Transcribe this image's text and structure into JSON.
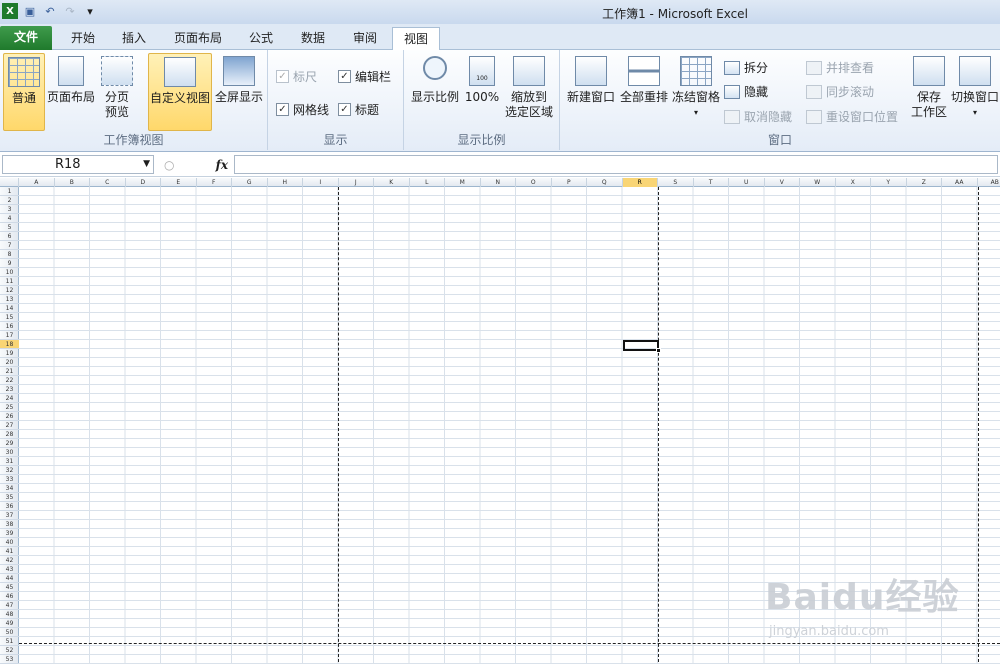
{
  "window": {
    "title": "工作簿1 - Microsoft Excel"
  },
  "tabs": {
    "file": "文件",
    "home": "开始",
    "insert": "插入",
    "page_layout": "页面布局",
    "formulas": "公式",
    "data": "数据",
    "review": "审阅",
    "view": "视图"
  },
  "ribbon": {
    "workbook_views": {
      "label": "工作簿视图",
      "normal": "普通",
      "page_layout": "页面布局",
      "page_break_1": "分页",
      "page_break_2": "预览",
      "custom_views": "自定义视图",
      "full_screen": "全屏显示"
    },
    "show": {
      "label": "显示",
      "ruler": "标尺",
      "formula_bar": "编辑栏",
      "gridlines": "网格线",
      "headings": "标题",
      "ruler_checked": "✓",
      "formula_bar_checked": "✓",
      "gridlines_checked": "✓",
      "headings_checked": "✓"
    },
    "zoom": {
      "label": "显示比例",
      "zoom": "显示比例",
      "zoom_100": "100%",
      "zoom_sel_1": "缩放到",
      "zoom_sel_2": "选定区域",
      "icon_100": "100"
    },
    "window": {
      "label": "窗口",
      "new_window": "新建窗口",
      "arrange_all": "全部重排",
      "freeze_panes": "冻结窗格",
      "split": "拆分",
      "hide": "隐藏",
      "unhide": "取消隐藏",
      "side_by_side": "并排查看",
      "sync_scroll": "同步滚动",
      "reset_pos": "重设窗口位置",
      "save_ws_1": "保存",
      "save_ws_2": "工作区",
      "switch_windows": "切换窗口"
    }
  },
  "formula_bar": {
    "name_box": "R18",
    "fx": "fx",
    "value": ""
  },
  "columns": [
    "A",
    "B",
    "C",
    "D",
    "E",
    "F",
    "G",
    "H",
    "I",
    "J",
    "K",
    "L",
    "M",
    "N",
    "O",
    "P",
    "Q",
    "R",
    "S",
    "T",
    "U",
    "V",
    "W",
    "X",
    "Y",
    "Z",
    "AA",
    "AB"
  ],
  "active_cell": {
    "column": "R",
    "row": 18
  },
  "rows": [
    "1",
    "2",
    "3",
    "4",
    "5",
    "6",
    "7",
    "8",
    "9",
    "10",
    "11",
    "12",
    "13",
    "14",
    "15",
    "16",
    "17",
    "18",
    "19",
    "20",
    "21",
    "22",
    "23",
    "24",
    "25",
    "26",
    "27",
    "28",
    "29",
    "30",
    "31",
    "32",
    "33",
    "34",
    "35",
    "36",
    "37",
    "38",
    "39",
    "40",
    "41",
    "42",
    "43",
    "44",
    "45",
    "46",
    "47",
    "48",
    "49",
    "50",
    "51",
    "52",
    "53"
  ],
  "watermark": {
    "logo": "Baidu经验",
    "url": "jingyan.baidu.com"
  }
}
